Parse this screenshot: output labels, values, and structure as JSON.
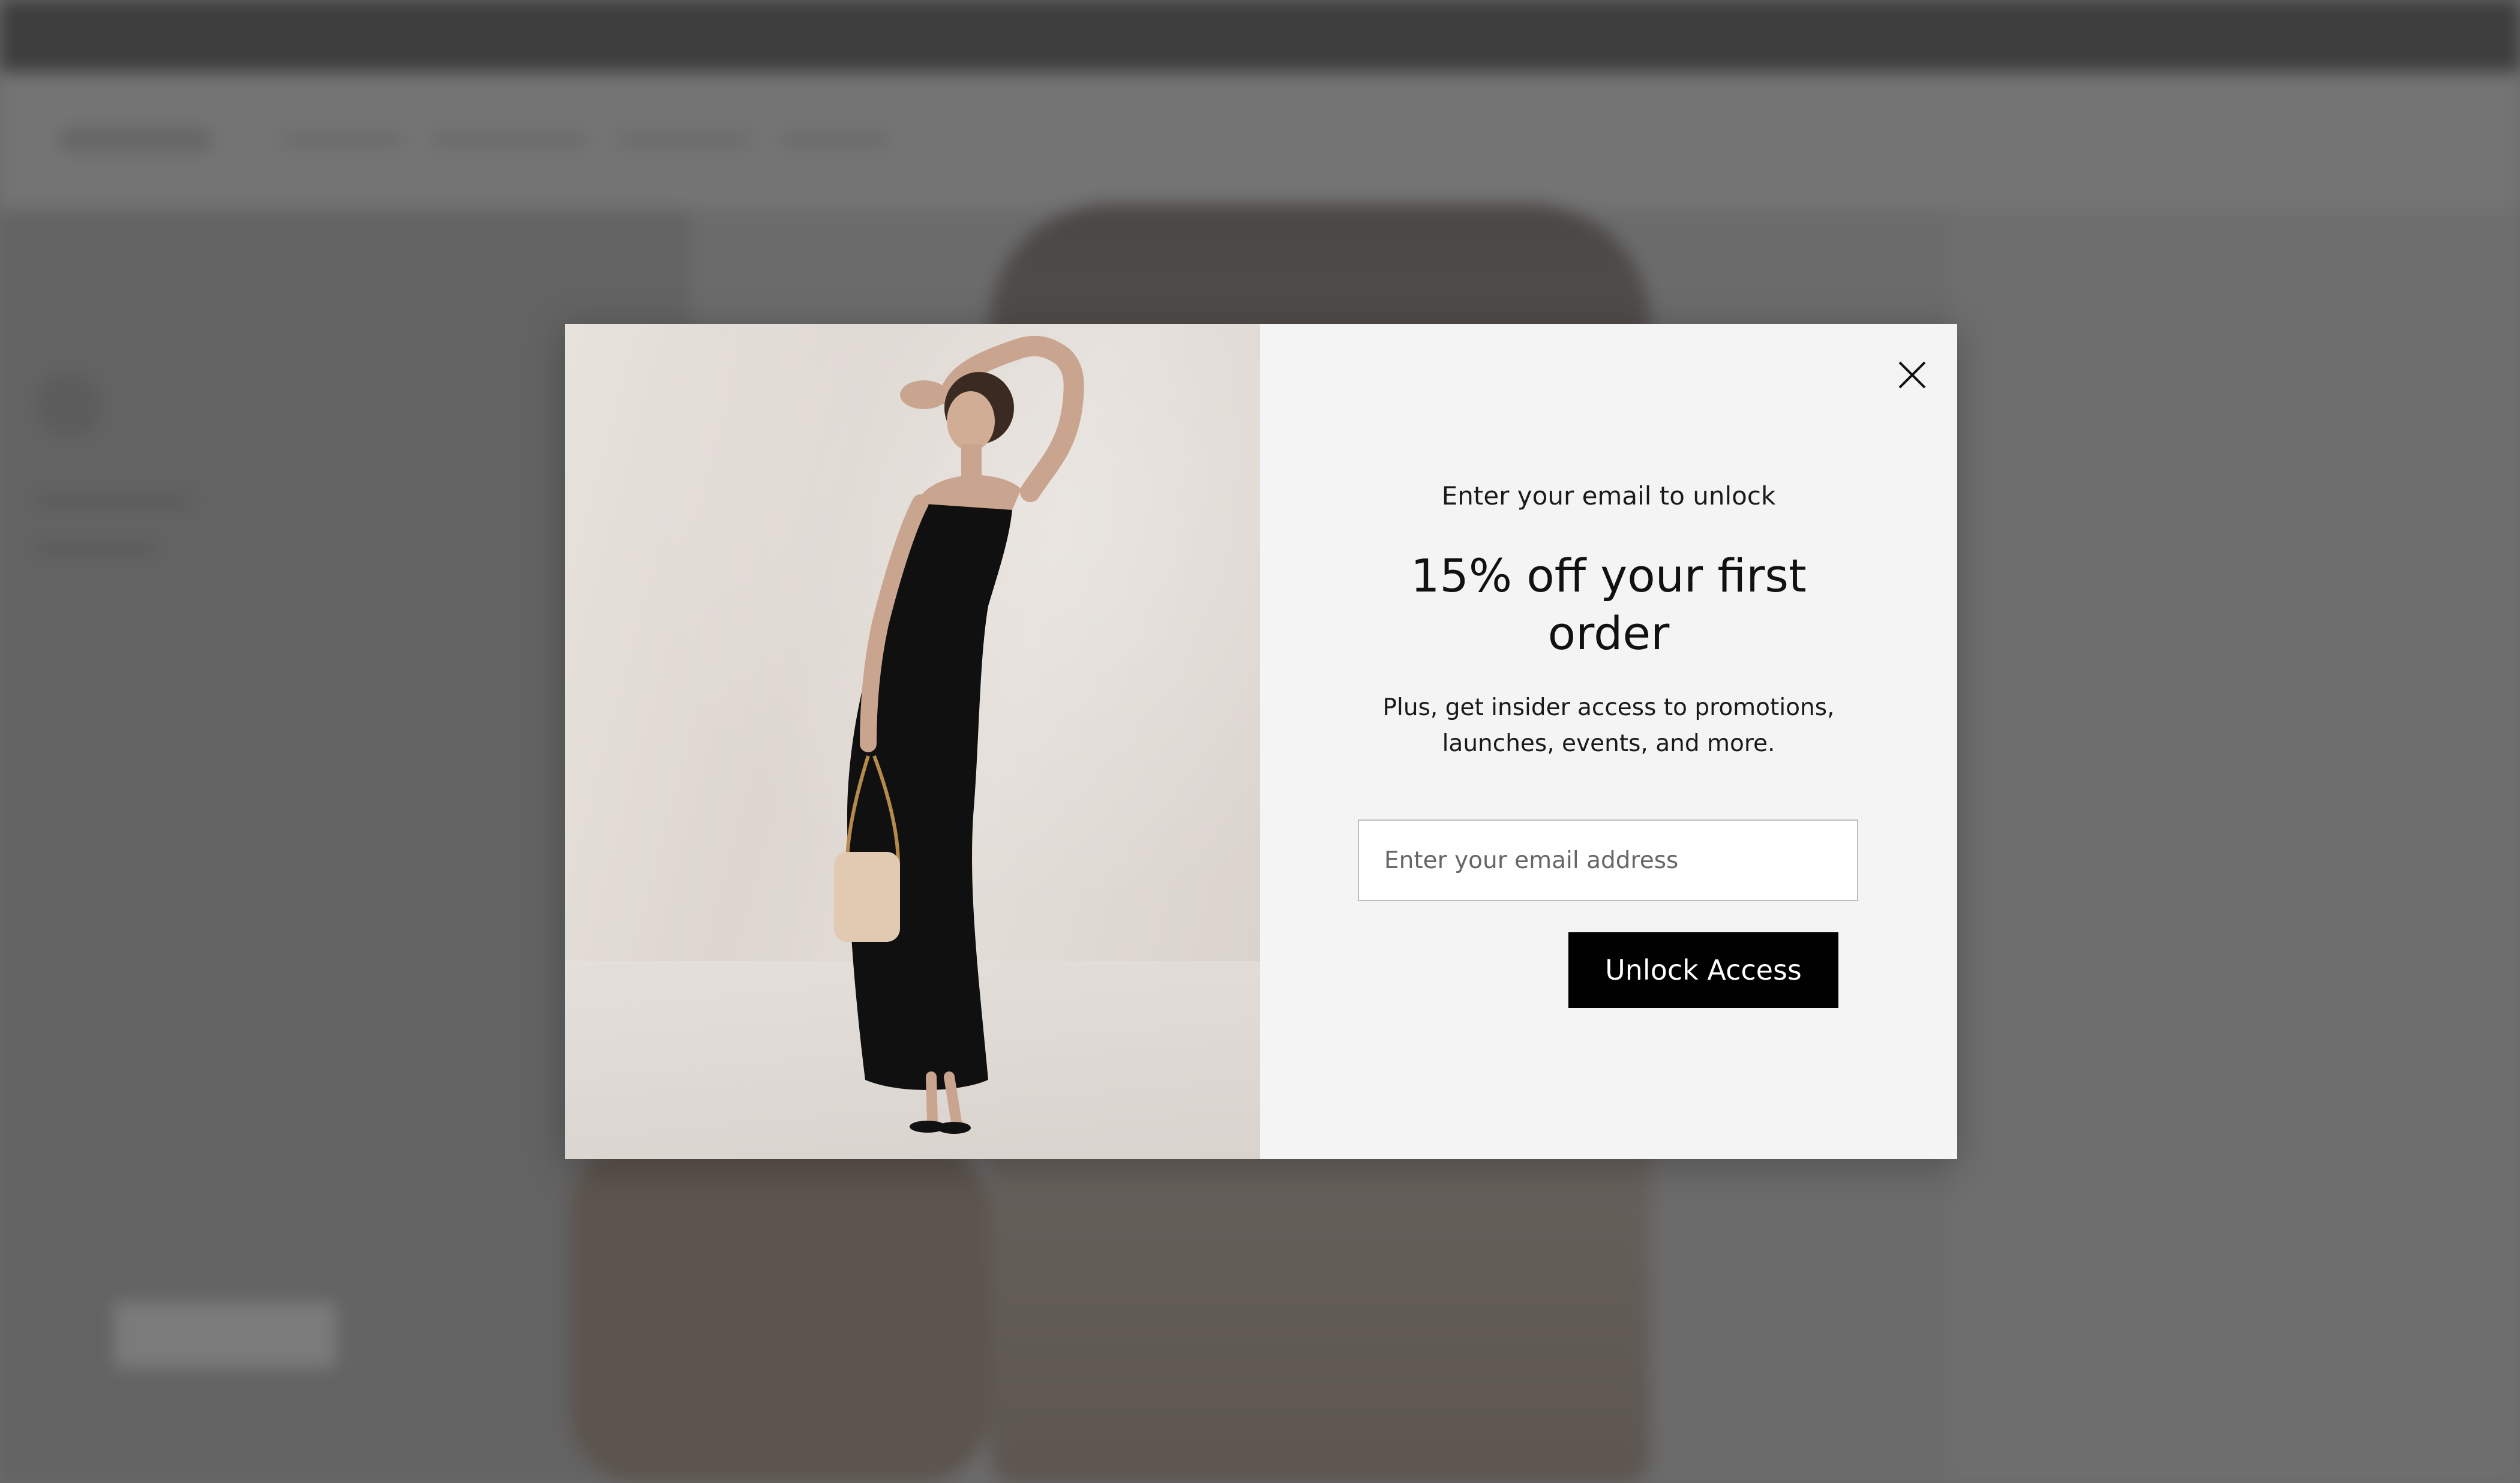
{
  "modal": {
    "eyebrow": "Enter your email to unlock",
    "headline": "15% off your first order",
    "subtext": "Plus, get insider access to promotions, launches, events, and more.",
    "email_placeholder": "Enter your email address",
    "email_value": "",
    "submit_label": "Unlock Access",
    "close_icon": "close-icon",
    "image_description_icon": "model-photo"
  },
  "colors": {
    "overlay": "#6a6a6a",
    "modal_panel": "#f4f4f4",
    "button_bg": "#000000",
    "button_text": "#ffffff",
    "dress": "#101010",
    "bag": "#e2c9b2"
  }
}
